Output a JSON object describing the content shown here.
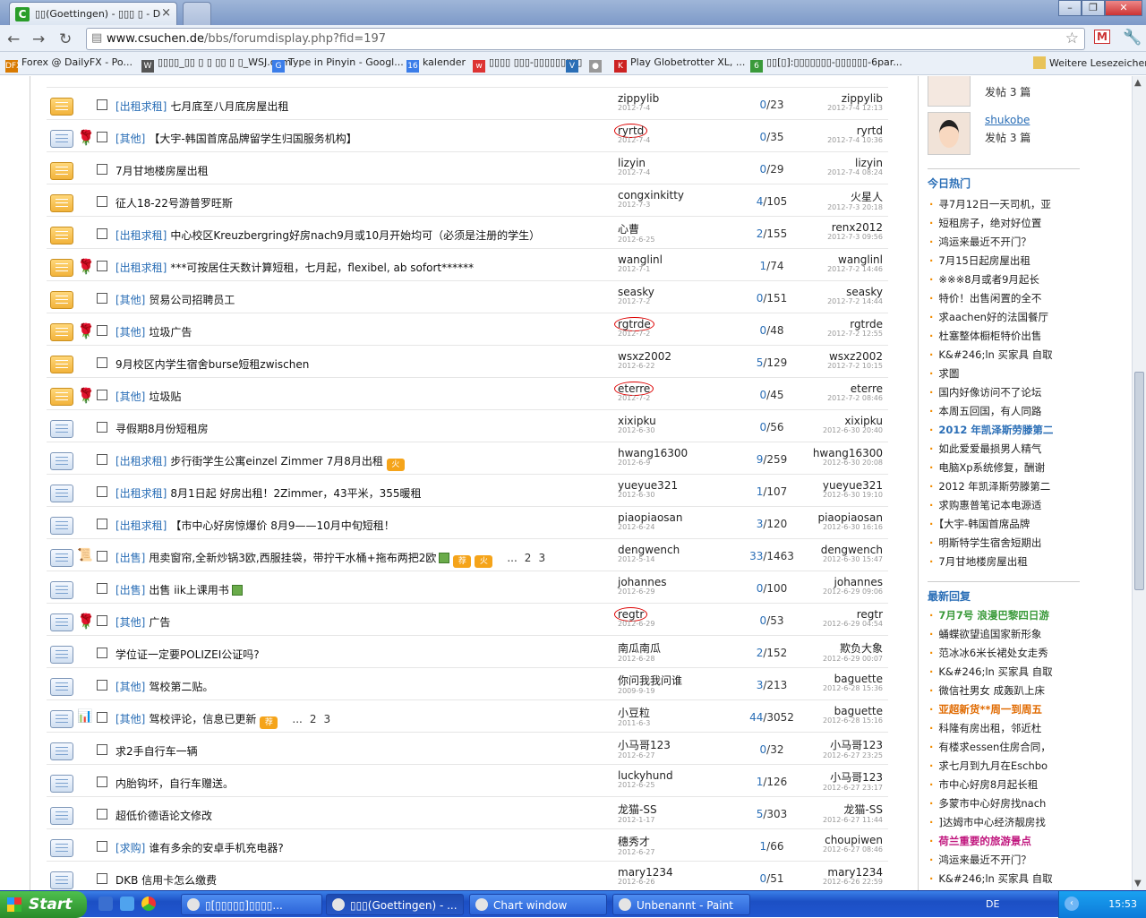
{
  "browser": {
    "tab_title": "▯▯(Goettingen) - ▯▯▯ ▯ - Design",
    "tab_close": "×",
    "url_domain": "www.csuchen.de",
    "url_path": "/bbs/forumdisplay.php?fid=197",
    "win_min": "–",
    "win_max": "❐",
    "win_close": "✕"
  },
  "bookmarks": [
    {
      "label": "Forex @ DailyFX - Po...",
      "icon_text": "DFX",
      "color": "#d97a00"
    },
    {
      "label": "▯▯▯▯_▯▯ ▯ ▯ ▯▯ ▯ ▯_WSJ.com",
      "icon_text": "W",
      "color": "#555"
    },
    {
      "label": "Type in Pinyin - Googl...",
      "icon_text": "G",
      "color": "#3b7de9"
    },
    {
      "label": "kalender",
      "icon_text": "16",
      "color": "#3b7de9"
    },
    {
      "label": "▯▯▯▯ ▯▯▯-▯▯▯▯▯▯▯▯▯",
      "icon_text": "w",
      "color": "#d33"
    },
    {
      "label": "",
      "icon_text": "V",
      "color": "#2a6eb6"
    },
    {
      "label": "",
      "icon_text": "●",
      "color": "#999"
    },
    {
      "label": "Play Globetrotter XL, ...",
      "icon_text": "K",
      "color": "#c22"
    },
    {
      "label": "▯▯[▯]:▯▯▯▯▯▯▯-▯▯▯▯▯▯-6par...",
      "icon_text": "6",
      "color": "#3a9a3a"
    },
    {
      "label": "Weitere Lesezeichen",
      "icon_text": "",
      "color": "#e8c35a"
    }
  ],
  "threads": [
    {
      "icon": "y",
      "rose": false,
      "cat": "[出租求租]",
      "title": "七月底至八月底房屋出租",
      "author": "zippylib",
      "adate": "2012-7-4",
      "circled": false,
      "replies": "0",
      "views": "23",
      "last": "zippylib",
      "ldate": "2012-7-4 12:13",
      "badges": [],
      "pages": []
    },
    {
      "icon": "b",
      "rose": true,
      "cat": "[其他]",
      "title": "【大宇-韩国首席品牌留学生归国服务机构】",
      "author": "ryrtd",
      "adate": "2012-7-4",
      "circled": true,
      "replies": "0",
      "views": "35",
      "last": "ryrtd",
      "ldate": "2012-7-4 10:36",
      "badges": [],
      "pages": []
    },
    {
      "icon": "y",
      "rose": false,
      "cat": "",
      "title": "7月甘地楼房屋出租",
      "author": "lizyin",
      "adate": "2012-7-4",
      "circled": false,
      "replies": "0",
      "views": "29",
      "last": "lizyin",
      "ldate": "2012-7-4 08:24",
      "badges": [],
      "pages": []
    },
    {
      "icon": "y",
      "rose": false,
      "cat": "",
      "title": "征人18-22号游普罗旺斯",
      "author": "congxinkitty",
      "adate": "2012-7-3",
      "circled": false,
      "replies": "4",
      "views": "105",
      "last": "火星人",
      "ldate": "2012-7-3 20:18",
      "badges": [],
      "pages": []
    },
    {
      "icon": "y",
      "rose": false,
      "cat": "[出租求租]",
      "title": "中心校区Kreuzbergring好房nach9月或10月开始均可（必须是注册的学生）",
      "author": "心曹",
      "adate": "2012-6-25",
      "circled": false,
      "replies": "2",
      "views": "155",
      "last": "renx2012",
      "ldate": "2012-7-3 09:56",
      "badges": [],
      "pages": []
    },
    {
      "icon": "y",
      "rose": true,
      "cat": "[出租求租]",
      "title": "***可按居住天数计算短租，七月起，flexibel, ab sofort******",
      "author": "wanglinl",
      "adate": "2012-7-1",
      "circled": false,
      "replies": "1",
      "views": "74",
      "last": "wanglinl",
      "ldate": "2012-7-2 14:46",
      "badges": [],
      "pages": []
    },
    {
      "icon": "y",
      "rose": false,
      "cat": "[其他]",
      "title": "贸易公司招聘员工",
      "author": "seasky",
      "adate": "2012-7-2",
      "circled": false,
      "replies": "0",
      "views": "151",
      "last": "seasky",
      "ldate": "2012-7-2 14:44",
      "badges": [],
      "pages": []
    },
    {
      "icon": "y",
      "rose": true,
      "cat": "[其他]",
      "title": "垃圾广告",
      "author": "rgtrde",
      "adate": "2012-7-2",
      "circled": true,
      "replies": "0",
      "views": "48",
      "last": "rgtrde",
      "ldate": "2012-7-2 12:55",
      "badges": [],
      "pages": []
    },
    {
      "icon": "y",
      "rose": false,
      "cat": "",
      "title": "9月校区内学生宿舍burse短租zwischen",
      "author": "wsxz2002",
      "adate": "2012-6-22",
      "circled": false,
      "replies": "5",
      "views": "129",
      "last": "wsxz2002",
      "ldate": "2012-7-2 10:15",
      "badges": [],
      "pages": []
    },
    {
      "icon": "y",
      "rose": true,
      "cat": "[其他]",
      "title": "垃圾贴",
      "author": "eterre",
      "adate": "2012-7-2",
      "circled": true,
      "replies": "0",
      "views": "45",
      "last": "eterre",
      "ldate": "2012-7-2 08:46",
      "badges": [],
      "pages": []
    },
    {
      "icon": "b",
      "rose": false,
      "cat": "",
      "title": "寻假期8月份短租房",
      "author": "xixipku",
      "adate": "2012-6-30",
      "circled": false,
      "replies": "0",
      "views": "56",
      "last": "xixipku",
      "ldate": "2012-6-30 20:40",
      "badges": [],
      "pages": []
    },
    {
      "icon": "b",
      "rose": false,
      "cat": "[出租求租]",
      "title": "步行街学生公寓einzel Zimmer 7月8月出租",
      "author": "hwang16300",
      "adate": "2012-6-9",
      "circled": false,
      "replies": "9",
      "views": "259",
      "last": "hwang16300",
      "ldate": "2012-6-30 20:08",
      "badges": [
        "火"
      ],
      "pages": []
    },
    {
      "icon": "b",
      "rose": false,
      "cat": "[出租求租]",
      "title": "8月1日起 好房出租！2Zimmer，43平米，355暖租",
      "author": "yueyue321",
      "adate": "2012-6-30",
      "circled": false,
      "replies": "1",
      "views": "107",
      "last": "yueyue321",
      "ldate": "2012-6-30 19:10",
      "badges": [],
      "pages": []
    },
    {
      "icon": "b",
      "rose": false,
      "cat": "[出租求租]",
      "title": "【市中心好房惊爆价 8月9——10月中旬短租！",
      "author": "piaopiaosan",
      "adate": "2012-6-24",
      "circled": false,
      "replies": "3",
      "views": "120",
      "last": "piaopiaosan",
      "ldate": "2012-6-30 16:16",
      "badges": [],
      "pages": []
    },
    {
      "icon": "b",
      "rose": false,
      "scroll": true,
      "cat": "[出售]",
      "title": "甩卖窗帘,全新炒锅3欧,西服挂袋，带拧干水桶+拖布两把2欧",
      "author": "dengwench",
      "adate": "2012-5-14",
      "circled": false,
      "replies": "33",
      "views": "1463",
      "last": "dengwench",
      "ldate": "2012-6-30 15:47",
      "badges": [
        "img",
        "荐",
        "火"
      ],
      "pages": [
        "...",
        "2",
        "3"
      ]
    },
    {
      "icon": "b",
      "rose": false,
      "cat": "[出售]",
      "title": "出售 iik上课用书",
      "author": "johannes",
      "adate": "2012-6-29",
      "circled": false,
      "replies": "0",
      "views": "100",
      "last": "johannes",
      "ldate": "2012-6-29 09:06",
      "badges": [
        "img"
      ],
      "pages": []
    },
    {
      "icon": "b",
      "rose": true,
      "cat": "[其他]",
      "title": "广告",
      "author": "regtr",
      "adate": "2012-6-29",
      "circled": true,
      "replies": "0",
      "views": "53",
      "last": "regtr",
      "ldate": "2012-6-29 04:54",
      "badges": [],
      "pages": []
    },
    {
      "icon": "b",
      "rose": false,
      "cat": "",
      "title": "学位证一定要POLIZEI公证吗?",
      "author": "南瓜南瓜",
      "adate": "2012-6-28",
      "circled": false,
      "replies": "2",
      "views": "152",
      "last": "欺负大象",
      "ldate": "2012-6-29 00:07",
      "badges": [],
      "pages": []
    },
    {
      "icon": "b",
      "rose": false,
      "cat": "[其他]",
      "title": "驾校第二贴。",
      "author": "你问我我问谁",
      "adate": "2009-9-19",
      "circled": false,
      "replies": "3",
      "views": "213",
      "last": "baguette",
      "ldate": "2012-6-28 15:36",
      "badges": [],
      "pages": []
    },
    {
      "icon": "b",
      "rose": false,
      "poll": true,
      "cat": "[其他]",
      "title": "驾校评论，信息已更新",
      "author": "小豆粒",
      "adate": "2011-6-3",
      "circled": false,
      "replies": "44",
      "views": "3052",
      "last": "baguette",
      "ldate": "2012-6-28 15:16",
      "badges": [
        "荐"
      ],
      "pages": [
        "...",
        "2",
        "3"
      ]
    },
    {
      "icon": "b",
      "rose": false,
      "cat": "",
      "title": "求2手自行车一辆",
      "author": "小马哥123",
      "adate": "2012-6-27",
      "circled": false,
      "replies": "0",
      "views": "32",
      "last": "小马哥123",
      "ldate": "2012-6-27 23:25",
      "badges": [],
      "pages": []
    },
    {
      "icon": "b",
      "rose": false,
      "cat": "",
      "title": "内胎钩坏，自行车赠送。",
      "author": "luckyhund",
      "adate": "2012-6-25",
      "circled": false,
      "replies": "1",
      "views": "126",
      "last": "小马哥123",
      "ldate": "2012-6-27 23:17",
      "badges": [],
      "pages": []
    },
    {
      "icon": "b",
      "rose": false,
      "cat": "",
      "title": "超低价德语论文修改",
      "author": "龙猫-SS",
      "adate": "2012-1-17",
      "circled": false,
      "replies": "5",
      "views": "303",
      "last": "龙猫-SS",
      "ldate": "2012-6-27 11:44",
      "badges": [],
      "pages": []
    },
    {
      "icon": "b",
      "rose": false,
      "cat": "[求购]",
      "title": "谁有多余的安卓手机充电器?",
      "author": "穗秀才",
      "adate": "2012-6-27",
      "circled": false,
      "replies": "1",
      "views": "66",
      "last": "choupiwen",
      "ldate": "2012-6-27 08:46",
      "badges": [],
      "pages": []
    },
    {
      "icon": "b",
      "rose": false,
      "cat": "",
      "title": "DKB 信用卡怎么缴费",
      "author": "mary1234",
      "adate": "2012-6-26",
      "circled": false,
      "replies": "0",
      "views": "51",
      "last": "mary1234",
      "ldate": "2012-6-26 22:59",
      "badges": [],
      "pages": []
    }
  ],
  "sidebar": {
    "users": [
      {
        "name": "",
        "posts": "发帖 3 篇"
      },
      {
        "name": "shukobe",
        "posts": "发帖 3 篇"
      }
    ],
    "hot_title": "今日热门",
    "hot": [
      {
        "t": "寻7月12日一天司机，亚",
        "s": ""
      },
      {
        "t": "短租房子，绝对好位置",
        "s": ""
      },
      {
        "t": "鸿运来最近不开门？",
        "s": ""
      },
      {
        "t": "7月15日起房屋出租",
        "s": ""
      },
      {
        "t": "※※※8月或者9月起长",
        "s": ""
      },
      {
        "t": "特价！出售闲置的全不",
        "s": ""
      },
      {
        "t": "求aachen好的法国餐厅",
        "s": ""
      },
      {
        "t": "杜塞整体橱柜特价出售",
        "s": ""
      },
      {
        "t": "K&#246;ln 买家具 自取",
        "s": ""
      },
      {
        "t": "求圖",
        "s": ""
      },
      {
        "t": "国内好像访问不了论坛",
        "s": ""
      },
      {
        "t": "本周五回国，有人同路",
        "s": ""
      },
      {
        "t": "2012 年凯泽斯劳滕第二",
        "s": "blue"
      },
      {
        "t": "如此爱爱最损男人精气",
        "s": ""
      },
      {
        "t": "电脑Xp系统修复，酬谢",
        "s": ""
      },
      {
        "t": "2012 年凯泽斯劳滕第二",
        "s": ""
      },
      {
        "t": "求购惠普笔记本电源适",
        "s": ""
      },
      {
        "t": "【大宇-韩国首席品牌",
        "s": ""
      },
      {
        "t": "明斯特学生宿舍短期出",
        "s": ""
      },
      {
        "t": "7月甘地楼房屋出租",
        "s": ""
      }
    ],
    "reply_title": "最新回复",
    "replies": [
      {
        "t": "7月7号 浪漫巴黎四日游",
        "s": "green"
      },
      {
        "t": "蛹蝶欲望追国家新形象",
        "s": ""
      },
      {
        "t": "范冰冰6米长裙处女走秀",
        "s": ""
      },
      {
        "t": "K&#246;ln 买家具 自取",
        "s": ""
      },
      {
        "t": "微信社男女 成轰趴上床",
        "s": ""
      },
      {
        "t": "亚超新货**周一到周五",
        "s": "orange"
      },
      {
        "t": "科隆有房出租，邻近杜",
        "s": ""
      },
      {
        "t": "有楼求essen住房合同，",
        "s": ""
      },
      {
        "t": "求七月到九月在Eschbo",
        "s": ""
      },
      {
        "t": "市中心好房8月起长租",
        "s": ""
      },
      {
        "t": "多蒙市中心好房找nach",
        "s": ""
      },
      {
        "t": "]达姆市中心经济靓房找",
        "s": ""
      },
      {
        "t": "荷兰重要的旅游景点",
        "s": "magenta"
      },
      {
        "t": "鸿运来最近不开门？",
        "s": ""
      },
      {
        "t": "K&#246;ln 买家具 自取",
        "s": ""
      }
    ]
  },
  "taskbar": {
    "start": "Start",
    "tasks": [
      {
        "label": "▯[▯▯▯▯▯]▯▯▯▯...",
        "active": false
      },
      {
        "label": "▯▯▯(Goettingen) - ...",
        "active": true
      },
      {
        "label": "Chart window",
        "active": false
      },
      {
        "label": "Unbenannt - Paint",
        "active": false
      }
    ],
    "lang": "DE",
    "clock": "15:53"
  }
}
